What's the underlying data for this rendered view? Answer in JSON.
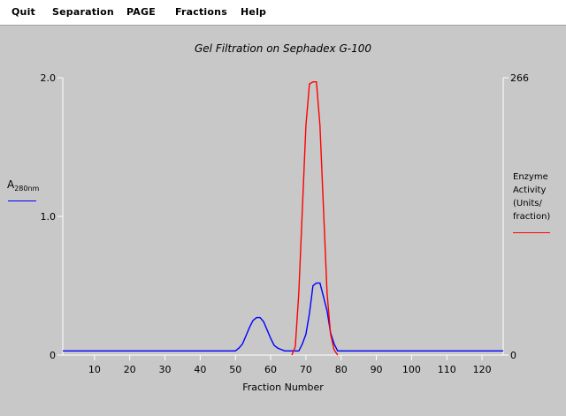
{
  "menu": [
    "Quit",
    "Separation",
    "PAGE",
    "Fractions",
    "Help"
  ],
  "title": "Gel Filtration on Sephadex G-100",
  "left_axis": {
    "label_main": "A",
    "label_sub": "280nm",
    "color": "#0000ff"
  },
  "right_axis": {
    "label_lines": [
      "Enzyme",
      "Activity",
      "(Units/",
      "fraction)"
    ],
    "color": "#ff0000"
  },
  "chart_data": {
    "type": "line",
    "xlabel": "Fraction Number",
    "xlim": [
      1,
      126
    ],
    "x_ticks": [
      10,
      20,
      30,
      40,
      50,
      60,
      70,
      80,
      90,
      100,
      110,
      120
    ],
    "left_ylim": [
      0,
      2.0
    ],
    "left_ticks": [
      {
        "value": 0,
        "label": "0"
      },
      {
        "value": 1.0,
        "label": "1.0"
      },
      {
        "value": 2.0,
        "label": "2.0"
      }
    ],
    "right_ylim": [
      0,
      266
    ],
    "right_ticks": [
      {
        "value": 0,
        "label": "0"
      },
      {
        "value": 266,
        "label": "266"
      }
    ],
    "series": [
      {
        "axis": "left",
        "color": "#0000ff",
        "x": [
          1,
          50,
          51,
          52,
          53,
          54,
          55,
          56,
          57,
          58,
          59,
          60,
          61,
          62,
          64,
          66,
          68,
          69,
          70,
          71,
          72,
          73,
          74,
          75,
          76,
          77,
          78,
          79,
          126
        ],
        "y": [
          0.03,
          0.03,
          0.05,
          0.08,
          0.14,
          0.2,
          0.25,
          0.27,
          0.27,
          0.24,
          0.18,
          0.12,
          0.07,
          0.05,
          0.03,
          0.03,
          0.03,
          0.08,
          0.15,
          0.3,
          0.5,
          0.52,
          0.52,
          0.42,
          0.32,
          0.16,
          0.08,
          0.03,
          0.03
        ]
      },
      {
        "axis": "right",
        "color": "#ff0000",
        "x": [
          66,
          67,
          68,
          69,
          70,
          71,
          72,
          73,
          74,
          75,
          76,
          77,
          78,
          79
        ],
        "y": [
          0,
          8,
          60,
          140,
          220,
          260,
          262,
          262,
          220,
          140,
          60,
          20,
          5,
          0
        ]
      }
    ]
  }
}
